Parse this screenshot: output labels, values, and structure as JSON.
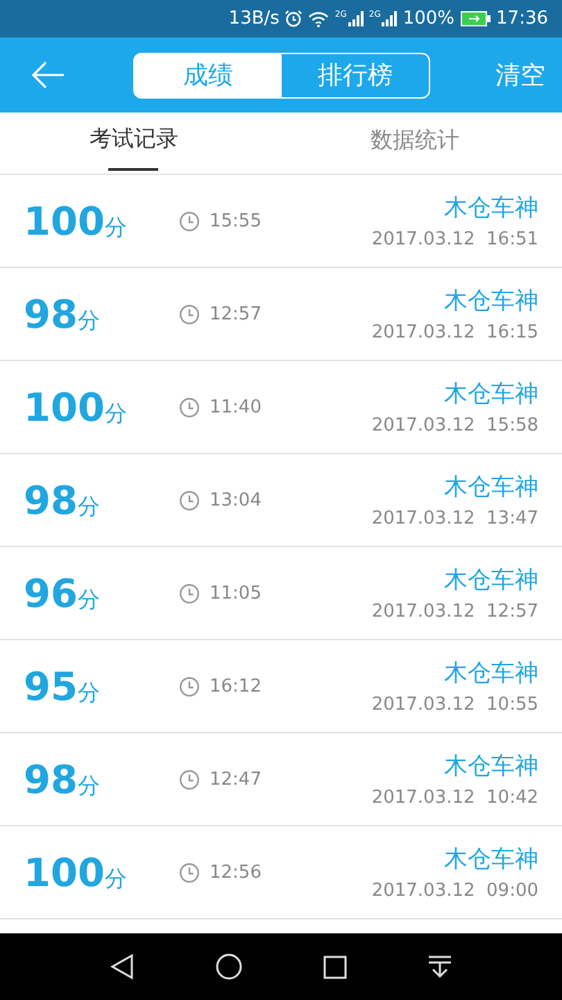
{
  "status_bar": {
    "speed": "13B/s",
    "network_1": "2G",
    "network_2": "2G",
    "battery": "100%",
    "time": "17:36"
  },
  "header": {
    "segments": [
      {
        "label": "成绩",
        "selected": true
      },
      {
        "label": "排行榜",
        "selected": false
      }
    ],
    "action": "清空"
  },
  "tabs": [
    {
      "label": "考试记录",
      "selected": true
    },
    {
      "label": "数据统计",
      "selected": false
    }
  ],
  "records": [
    {
      "score": "100",
      "unit": "分",
      "duration": "15:55",
      "name": "木仓车神",
      "date": "2017.03.12  16:51"
    },
    {
      "score": "98",
      "unit": "分",
      "duration": "12:57",
      "name": "木仓车神",
      "date": "2017.03.12  16:15"
    },
    {
      "score": "100",
      "unit": "分",
      "duration": "11:40",
      "name": "木仓车神",
      "date": "2017.03.12  15:58"
    },
    {
      "score": "98",
      "unit": "分",
      "duration": "13:04",
      "name": "木仓车神",
      "date": "2017.03.12  13:47"
    },
    {
      "score": "96",
      "unit": "分",
      "duration": "11:05",
      "name": "木仓车神",
      "date": "2017.03.12  12:57"
    },
    {
      "score": "95",
      "unit": "分",
      "duration": "16:12",
      "name": "木仓车神",
      "date": "2017.03.12  10:55"
    },
    {
      "score": "98",
      "unit": "分",
      "duration": "12:47",
      "name": "木仓车神",
      "date": "2017.03.12  10:42"
    },
    {
      "score": "100",
      "unit": "分",
      "duration": "12:56",
      "name": "木仓车神",
      "date": "2017.03.12  09:00"
    }
  ]
}
